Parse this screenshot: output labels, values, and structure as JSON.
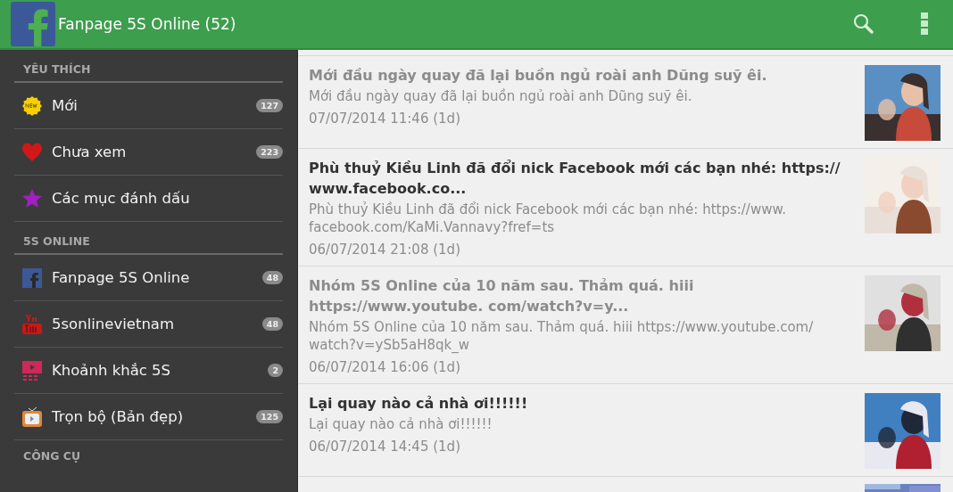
{
  "app_bar": {
    "title": "Fanpage 5S Online (52)"
  },
  "sidebar": {
    "sections": [
      {
        "header": "YÊU THÍCH",
        "items": [
          {
            "label": "Mới",
            "kind": "new",
            "count": "127"
          },
          {
            "label": "Chưa xem",
            "kind": "heart",
            "count": "223"
          },
          {
            "label": "Các mục đánh dấu",
            "kind": "star"
          }
        ]
      },
      {
        "header": "5S ONLINE",
        "items": [
          {
            "label": "Fanpage 5S Online",
            "kind": "facebook",
            "count": "48"
          },
          {
            "label": "5sonlinevietnam",
            "kind": "youtube",
            "count": "48"
          },
          {
            "label": "Khoảnh khắc 5S",
            "kind": "film",
            "count": "2"
          },
          {
            "label": "Trọn bộ (Bản đẹp)",
            "kind": "tv",
            "count": "125"
          }
        ]
      },
      {
        "header": "CÔNG CỤ"
      }
    ]
  },
  "posts": [
    {
      "title": "Mới đầu ngày quay đã lại buồn ngủ roài anh Dũng suỹ êi.",
      "summary": "Mới đầu ngày quay đã lại buồn ngủ roài anh Dũng suỹ êi.",
      "date": "07/07/2014 11:46 (1d)",
      "read": true
    },
    {
      "title": "Phù thuỷ Kiều Linh đã đổi nick Facebook mới các bạn nhé: https:// www.facebook.co...",
      "summary": "Phù thuỷ Kiều Linh đã đổi nick Facebook mới các bạn nhé: https://www. facebook.com/KaMi.Vannavy?fref=ts",
      "date": "06/07/2014 21:08 (1d)",
      "read": false
    },
    {
      "title": "Nhóm 5S Online của 10 năm sau. Thảm quá. hiii https://www.youtube. com/watch?v=y...",
      "summary": "Nhóm 5S Online của 10 năm sau. Thảm quá. hiii https://www.youtube.com/ watch?v=ySb5aH8qk_w",
      "date": "06/07/2014 16:06 (1d)",
      "read": true
    },
    {
      "title": "Lại quay nào cả nhà ơi!!!!!!",
      "summary": "Lại quay nào cả nhà ơi!!!!!!",
      "date": "06/07/2014 14:45 (1d)",
      "read": false
    }
  ]
}
